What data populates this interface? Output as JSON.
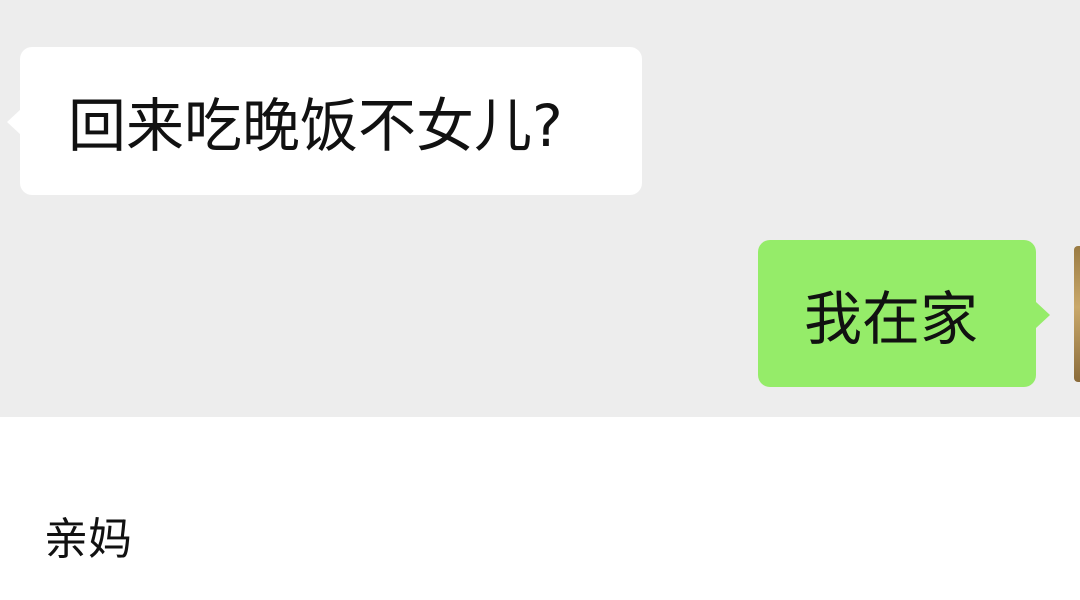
{
  "chat": {
    "messages": [
      {
        "direction": "incoming",
        "text": "回来吃晚饭不女儿?"
      },
      {
        "direction": "outgoing",
        "text": "我在家"
      }
    ]
  },
  "contact": {
    "name": "亲妈"
  },
  "colors": {
    "chat_background": "#ededed",
    "incoming_bubble": "#ffffff",
    "outgoing_bubble": "#95ec69",
    "panel_background": "#ffffff",
    "text": "#111111"
  }
}
